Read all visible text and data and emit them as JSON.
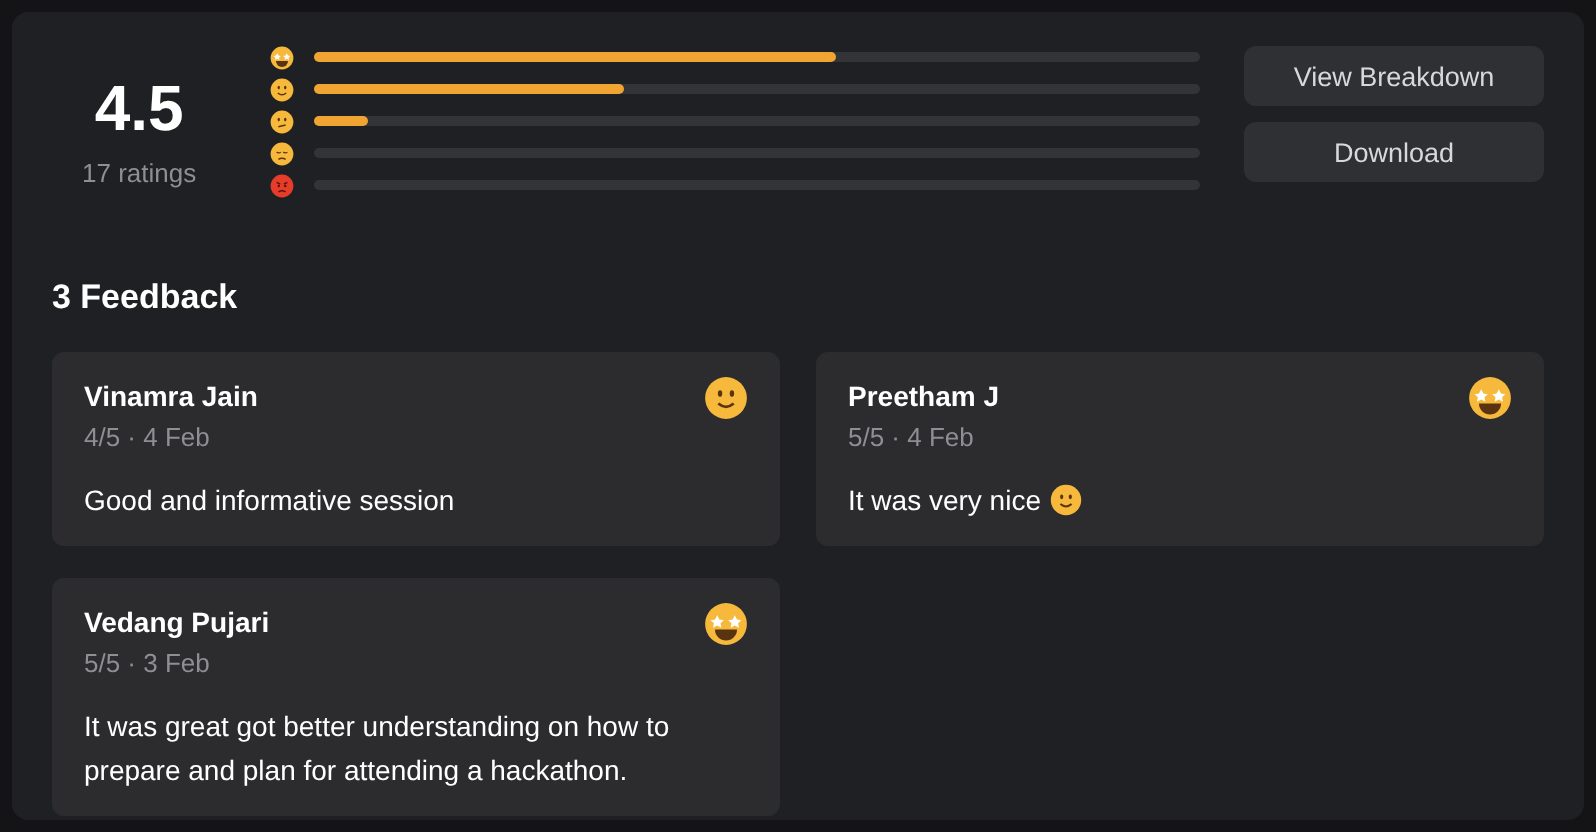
{
  "summary": {
    "score": "4.5",
    "count": "17 ratings"
  },
  "distribution": [
    {
      "face": {
        "kind": "starstruck"
      },
      "level": 0.59
    },
    {
      "face": {
        "kind": "smile"
      },
      "level": 0.35
    },
    {
      "face": {
        "kind": "confused"
      },
      "level": 0.06
    },
    {
      "face": {
        "kind": "sad"
      }
    },
    {
      "face": {
        "kind": "angry"
      }
    }
  ],
  "buttons": [
    "View Breakdown",
    "Download"
  ],
  "feedback_title": "3 Feedback",
  "feedback": [
    {
      "name": "Vinamra Jain",
      "meta": "4/5 · 4 Feb",
      "face": {
        "kind": "smile"
      },
      "comment": "Good and informative session"
    },
    {
      "name": "Preetham J",
      "meta": "5/5 · 4 Feb",
      "face": {
        "kind": "starstruck"
      },
      "comment": "It was very nice",
      "comment_face": {
        "kind": "smile"
      }
    },
    {
      "name": "Vedang Pujari",
      "meta": "5/5 · 3 Feb",
      "face": {
        "kind": "starstruck"
      },
      "comment": "It was great got better understanding on how to prepare and plan for attending a hackathon."
    }
  ]
}
